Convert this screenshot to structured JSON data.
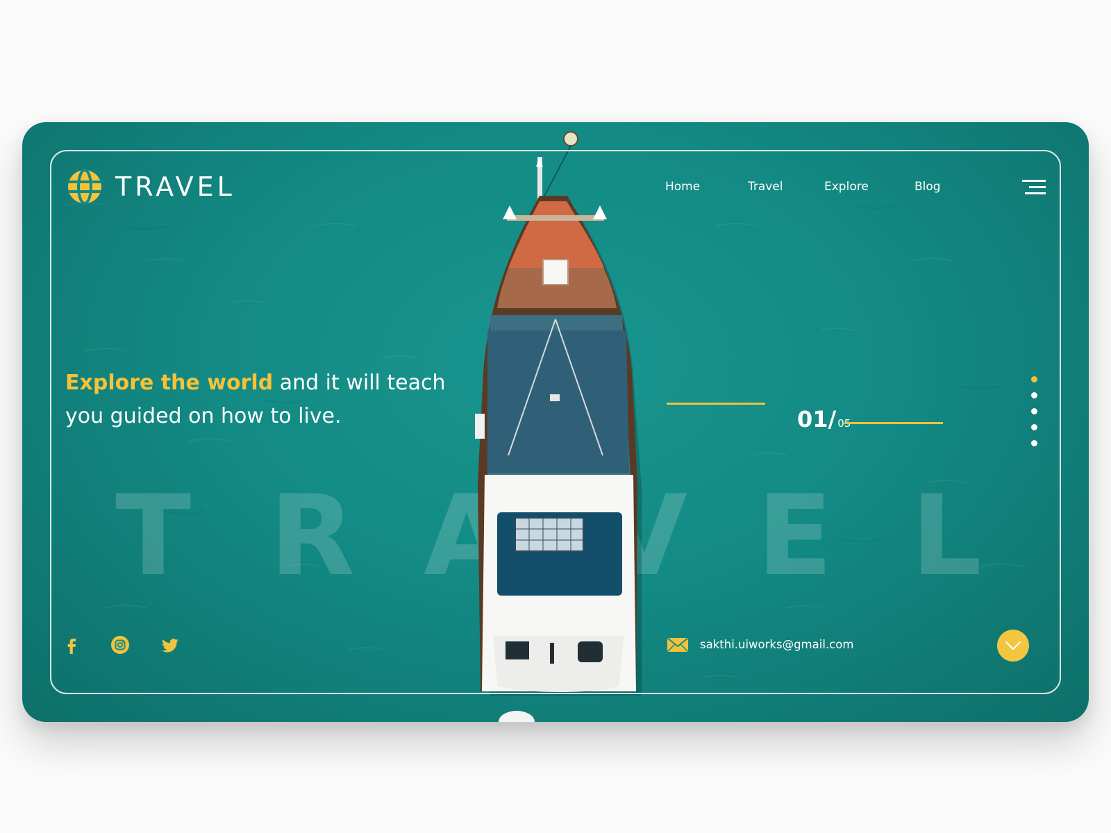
{
  "brand": {
    "name": "TRAVEL",
    "icon": "globe-icon"
  },
  "nav": {
    "items": [
      {
        "label": "Home"
      },
      {
        "label": "Travel"
      },
      {
        "label": "Explore"
      },
      {
        "label": "Blog"
      }
    ],
    "menu_icon": "hamburger-menu-icon"
  },
  "hero": {
    "headline_accent": "Explore the world",
    "headline_rest": " and it will teach you guided on how to live.",
    "background_word": [
      "T",
      "R",
      "A",
      "V",
      "E",
      "L"
    ]
  },
  "slider": {
    "current": "01/",
    "total": "05",
    "dots_count": 5,
    "active_dot": 1
  },
  "social": {
    "icons": [
      "facebook-icon",
      "instagram-icon",
      "twitter-icon"
    ]
  },
  "contact": {
    "email": "sakthi.uiworks@gmail.com",
    "icon": "mail-icon"
  },
  "scroll_button": {
    "icon": "chevron-down-icon"
  },
  "colors": {
    "accent": "#f5c33b",
    "background": "#138a84",
    "text": "#ffffff"
  }
}
